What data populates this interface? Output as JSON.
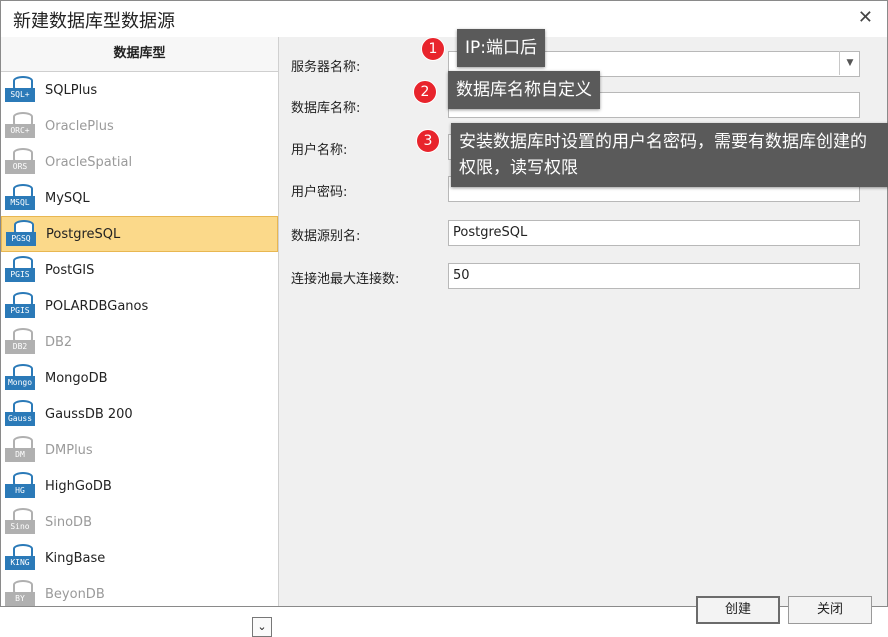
{
  "window": {
    "title": "新建数据库型数据源",
    "close_glyph": "✕"
  },
  "sidebar": {
    "header": "数据库型",
    "items": [
      {
        "label": "SQLPlus",
        "tag": "SQL+",
        "disabled": false,
        "selected": false
      },
      {
        "label": "OraclePlus",
        "tag": "ORC+",
        "disabled": true,
        "selected": false
      },
      {
        "label": "OracleSpatial",
        "tag": "ORS",
        "disabled": true,
        "selected": false
      },
      {
        "label": "MySQL",
        "tag": "MSQL",
        "disabled": false,
        "selected": false
      },
      {
        "label": "PostgreSQL",
        "tag": "PGSQ",
        "disabled": false,
        "selected": true
      },
      {
        "label": "PostGIS",
        "tag": "PGIS",
        "disabled": false,
        "selected": false
      },
      {
        "label": "POLARDBGanos",
        "tag": "PGIS",
        "disabled": false,
        "selected": false
      },
      {
        "label": "DB2",
        "tag": "DB2",
        "disabled": true,
        "selected": false
      },
      {
        "label": "MongoDB",
        "tag": "Mongo",
        "disabled": false,
        "selected": false
      },
      {
        "label": "GaussDB 200",
        "tag": "Gauss",
        "disabled": false,
        "selected": false
      },
      {
        "label": "DMPlus",
        "tag": "DM",
        "disabled": true,
        "selected": false
      },
      {
        "label": "HighGoDB",
        "tag": "HG",
        "disabled": false,
        "selected": false
      },
      {
        "label": "SinoDB",
        "tag": "Sino",
        "disabled": true,
        "selected": false
      },
      {
        "label": "KingBase",
        "tag": "KING",
        "disabled": false,
        "selected": false
      },
      {
        "label": "BeyonDB",
        "tag": "BY",
        "disabled": true,
        "selected": false
      }
    ],
    "scroll_glyph": "⌄"
  },
  "form": {
    "server_label": "服务器名称:",
    "server_value": "",
    "database_label": "数据库名称:",
    "database_value": "",
    "user_label": "用户名称:",
    "user_value": "",
    "password_label": "用户密码:",
    "password_value": "",
    "alias_label": "数据源别名:",
    "alias_value": "PostgreSQL",
    "pool_label": "连接池最大连接数:",
    "pool_value": "50"
  },
  "callouts": [
    {
      "badge": "1",
      "text": "IP:端口后"
    },
    {
      "badge": "2",
      "text": "数据库名称自定义"
    },
    {
      "badge": "3",
      "text": "安装数据库时设置的用户名密码，需要有数据库创建的权限，读写权限"
    }
  ],
  "buttons": {
    "create": "创建",
    "close": "关闭"
  },
  "colors": {
    "selected_bg": "#fbd98a",
    "callout_bg": "#5a5a5a",
    "badge_red": "#e8242c",
    "icon_blue": "#2b7ab8"
  }
}
